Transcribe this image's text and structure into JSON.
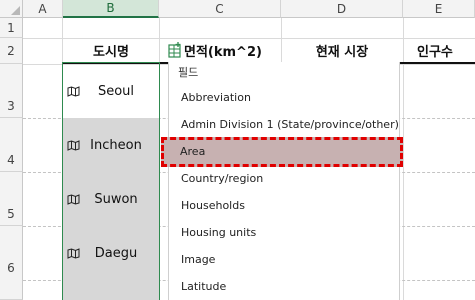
{
  "columns": [
    "A",
    "B",
    "C",
    "D",
    "E"
  ],
  "rows": [
    "1",
    "2",
    "3",
    "4",
    "5",
    "6"
  ],
  "header_row": {
    "b": "도시명",
    "c": "면적(km^2)",
    "d": "현재 시장",
    "e": "인구수"
  },
  "cities": [
    "Seoul",
    "Incheon",
    "Suwon",
    "Daegu"
  ],
  "field_panel": {
    "title": "필드",
    "items": [
      "Abbreviation",
      "Admin Division 1 (State/province/other)",
      "Area",
      "Country/region",
      "Households",
      "Housing units",
      "Image",
      "Latitude"
    ],
    "highlighted": "Area"
  },
  "colors": {
    "selection_green": "#217346",
    "highlight_red": "#e00000",
    "geo_cell_gray": "#d7d7d7"
  }
}
